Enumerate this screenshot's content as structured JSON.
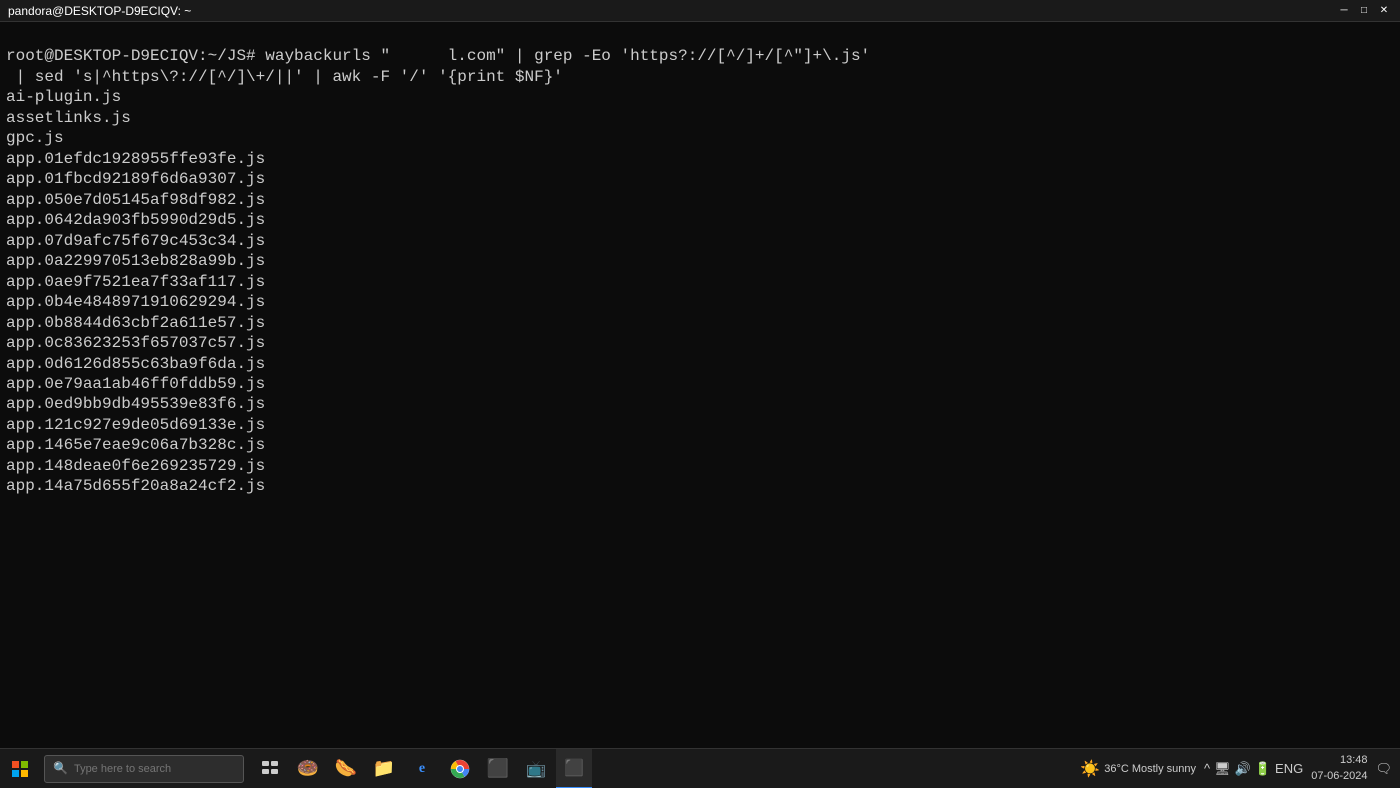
{
  "titlebar": {
    "title": "pandora@DESKTOP-D9ECIQV: ~",
    "min_label": "─",
    "max_label": "□",
    "close_label": "✕"
  },
  "terminal": {
    "prompt_line": "root@DESKTOP-D9ECIQV:~/JS# waybackurls \"",
    "command_suffix": "l.com\" | grep -Eo 'https?://[^/]+/[^\"]+\\.js'",
    "pipe_line": " | sed 's|^https\\?://[^/]\\+/||' | awk -F '/' '{print $NF}'",
    "output_lines": [
      "ai-plugin.js",
      "assetlinks.js",
      "gpc.js",
      "app.01efdc1928955ffe93fe.js",
      "app.01fbcd92189f6d6a9307.js",
      "app.050e7d05145af98df982.js",
      "app.0642da903fb5990d29d5.js",
      "app.07d9afc75f679c453c34.js",
      "app.0a229970513eb828a99b.js",
      "app.0ae9f7521ea7f33af117.js",
      "app.0b4e4848971910629294.js",
      "app.0b8844d63cbf2a611e57.js",
      "app.0c83623253f657037c57.js",
      "app.0d6126d855c63ba9f6da.js",
      "app.0e79aa1ab46ff0fddb59.js",
      "app.0ed9bb9db495539e83f6.js",
      "app.121c927e9de05d69133e.js",
      "app.1465e7eae9c06a7b328c.js",
      "app.148deae0f6e269235729.js",
      "app.14a75d655f20a8a24cf2.js"
    ]
  },
  "taskbar": {
    "search_placeholder": "Type here to search",
    "weather": "36°C  Mostly sunny",
    "time": "13:48",
    "date": "07-06-2024",
    "lang": "ENG"
  }
}
